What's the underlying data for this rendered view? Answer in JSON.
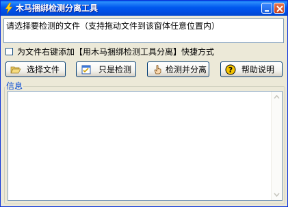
{
  "window": {
    "title": "木马捆绑检测分离工具"
  },
  "titlebar": {
    "icons": {
      "app": "lightning-icon",
      "minimize": "minimize-icon",
      "close": "close-icon"
    }
  },
  "path_box": {
    "text": "请选择要检测的文件（支持拖动文件到该窗体任意位置内）"
  },
  "context_menu_option": {
    "checked": false,
    "label": "为文件右键添加【用木马捆绑检测工具分离】快捷方式"
  },
  "buttons": {
    "select_file": {
      "label": "选择文件",
      "icon": "folder-open-icon"
    },
    "check_only": {
      "label": "只是检测",
      "icon": "checklist-icon"
    },
    "check_and_separate": {
      "label": "检测并分离",
      "icon": "hand-pointer-icon"
    },
    "help": {
      "label": "帮助说明",
      "icon": "question-icon"
    }
  },
  "info": {
    "title": "信息",
    "content": ""
  },
  "colors": {
    "title_bar": "#0054e3",
    "window_bg": "#ece9d8",
    "group_title": "#0046d5"
  }
}
